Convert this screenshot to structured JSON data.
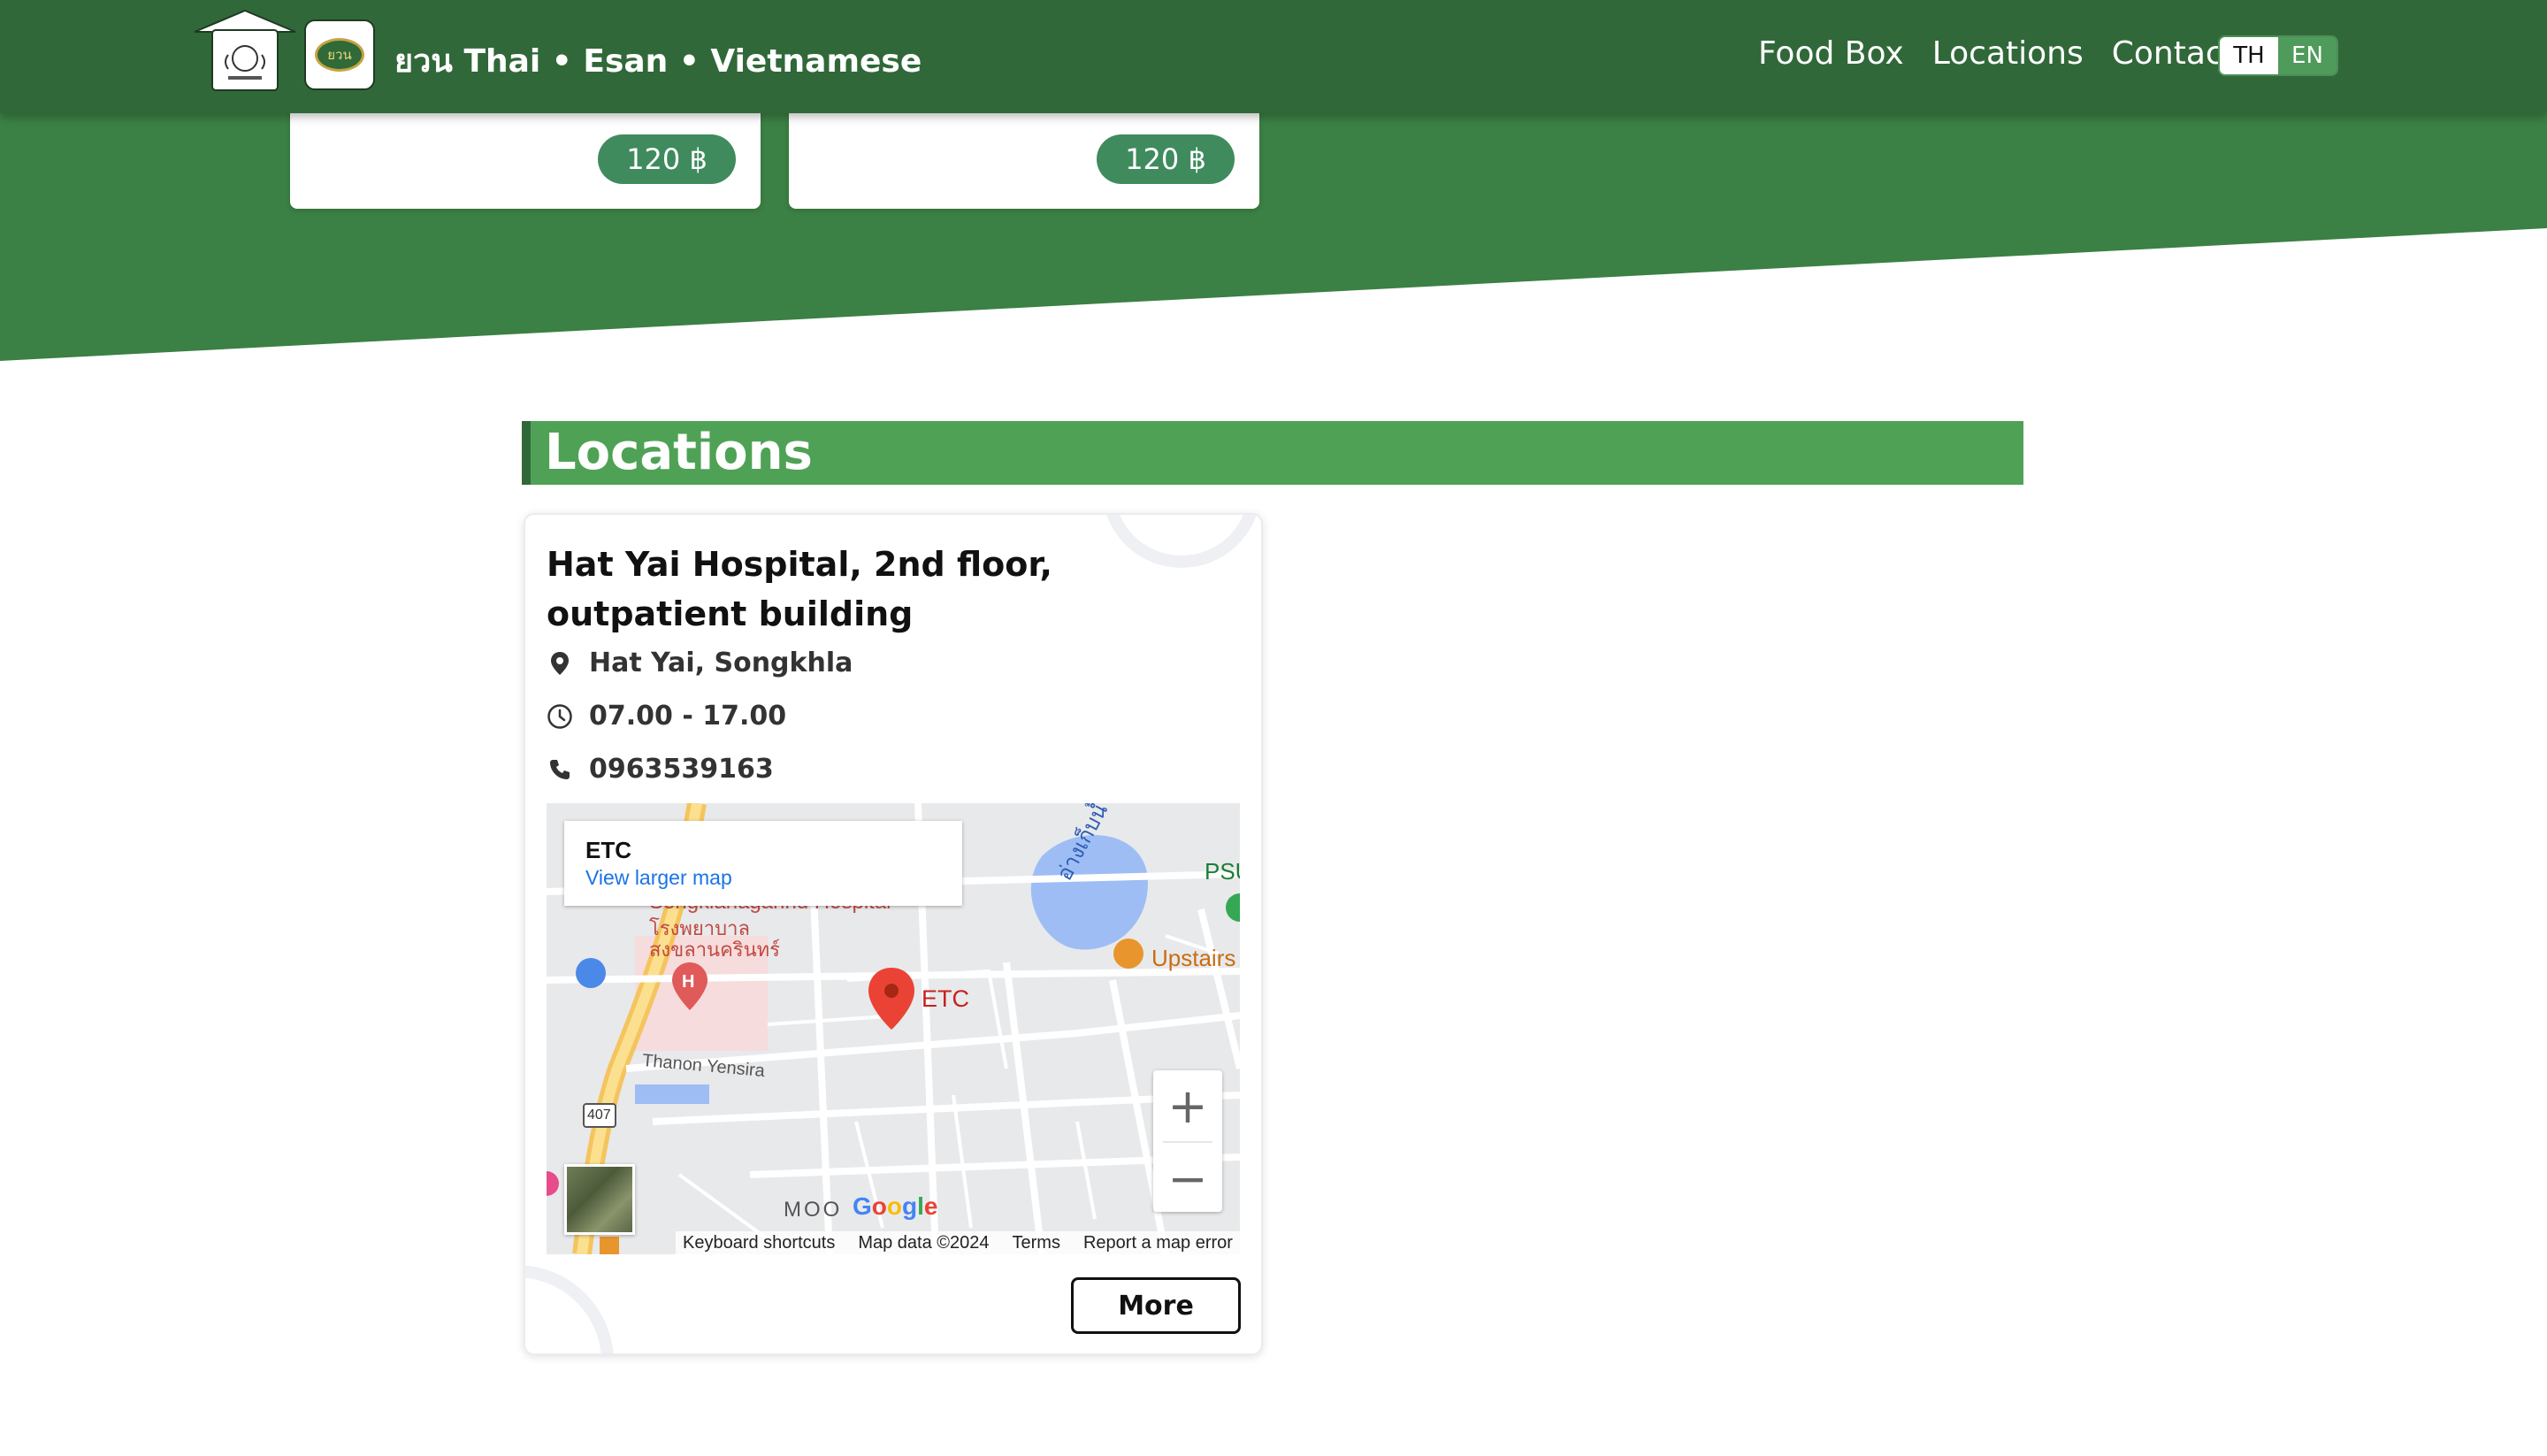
{
  "header": {
    "brand": "ยวน  Thai • Esan • Vietnamese",
    "logo_badge_text": "ยวน",
    "nav": [
      "Food Box",
      "Locations",
      "Contact"
    ],
    "lang": {
      "th": "TH",
      "en": "EN",
      "active": "TH"
    }
  },
  "food_cards": [
    {
      "price": "120 ฿"
    },
    {
      "price": "120 ฿"
    }
  ],
  "locations": {
    "title": "Locations",
    "cards": [
      {
        "name": "Hat Yai Hospital, 2nd floor, outpatient building",
        "area": "Hat Yai, Songkhla",
        "hours": "07.00 - 17.00",
        "phone": "0963539163",
        "more_label": "More",
        "map": {
          "place_name": "ETC",
          "view_larger": "View larger map",
          "pin_label": "ETC",
          "labels": {
            "hospital_en": "Songklanagarind Hospital",
            "hospital_th_1": "โรงพยาบาล",
            "hospital_th_2": "สงขลานครินทร์",
            "lake_th": "อ่างเก็บน้ำ",
            "cafe": "Upstairs",
            "psu": "PSU",
            "road": "Thanon Yensira",
            "route": "407",
            "moo": "MOO"
          },
          "google": "Google",
          "footer": [
            "Keyboard shortcuts",
            "Map data ©2024",
            "Terms",
            "Report a map error"
          ],
          "zoom_in": "+",
          "zoom_out": "−"
        }
      }
    ]
  },
  "colors": {
    "nav_bg": "#316839",
    "hero_bg": "#3b8044",
    "section_bar": "#4fa255",
    "price_badge": "#3f8b5e"
  },
  "icons": [
    "map-pin-icon",
    "clock-icon",
    "phone-icon"
  ]
}
